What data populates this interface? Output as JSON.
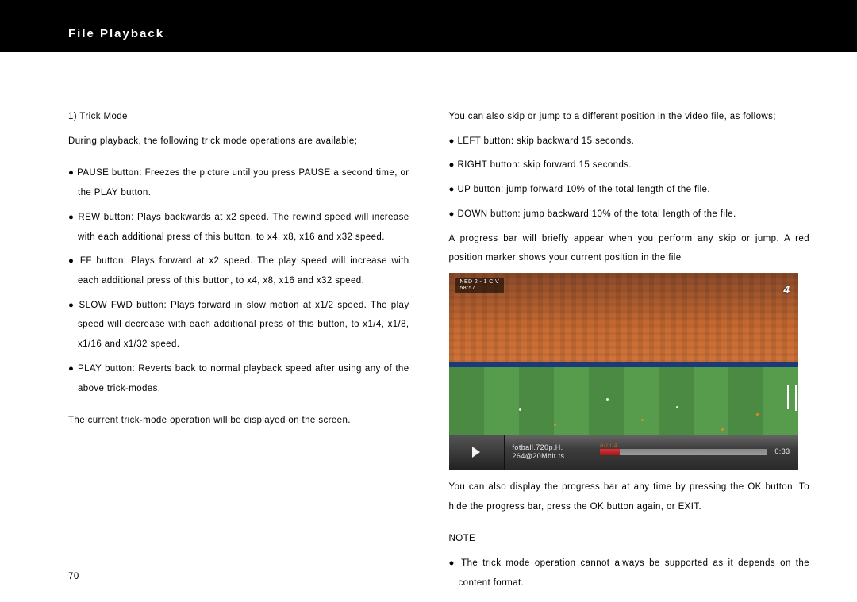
{
  "header": {
    "title": "File Playback"
  },
  "left": {
    "heading": "1) Trick Mode",
    "intro": "During playback, the following trick mode operations are available;",
    "bullets": [
      "● PAUSE button: Freezes the picture until you press PAUSE a second time, or the PLAY button.",
      "● REW button: Plays backwards at x2 speed.  The rewind speed will increase with each additional press of this button, to x4, x8, x16 and x32 speed.",
      "● FF button: Plays forward at x2 speed.  The play speed will increase with each additional press of this button, to x4, x8, x16 and x32 speed.",
      "● SLOW FWD button: Plays forward in slow motion at x1/2 speed.  The play speed will decrease with each additional press of this button, to x1/4, x1/8, x1/16 and x1/32 speed.",
      "● PLAY button: Reverts back to normal playback speed after using any of the above trick-modes."
    ],
    "outro": "The current trick-mode operation will be displayed on the screen."
  },
  "right": {
    "intro": "You can also skip or jump to a different position in the video file, as follows;",
    "bullets": [
      "● LEFT button: skip backward 15 seconds.",
      "● RIGHT button: skip forward 15 seconds.",
      "● UP button: jump forward 10% of the total length of the file.",
      "● DOWN button: jump backward 10% of the total length of the file."
    ],
    "progress_note": "A progress bar will briefly appear when you perform any skip or jump.  A red position marker shows your current position in the file",
    "after_image": "You can also display the progress bar at any time by pressing the OK button.   To hide the progress bar, press the OK button again, or EXIT.",
    "note_heading": "NOTE",
    "note_bullet": "● The trick mode operation cannot always be supported as it depends on the content format."
  },
  "player": {
    "scoreboard_line1": "NED 2 - 1 CIV",
    "scoreboard_line2": "58:57",
    "channel_logo": "4",
    "file_line1": "fotball.720p.H.",
    "file_line2": "264@20Mbit.ts",
    "time_current": "A0:04",
    "time_total": "0:33"
  },
  "page_number": "70"
}
